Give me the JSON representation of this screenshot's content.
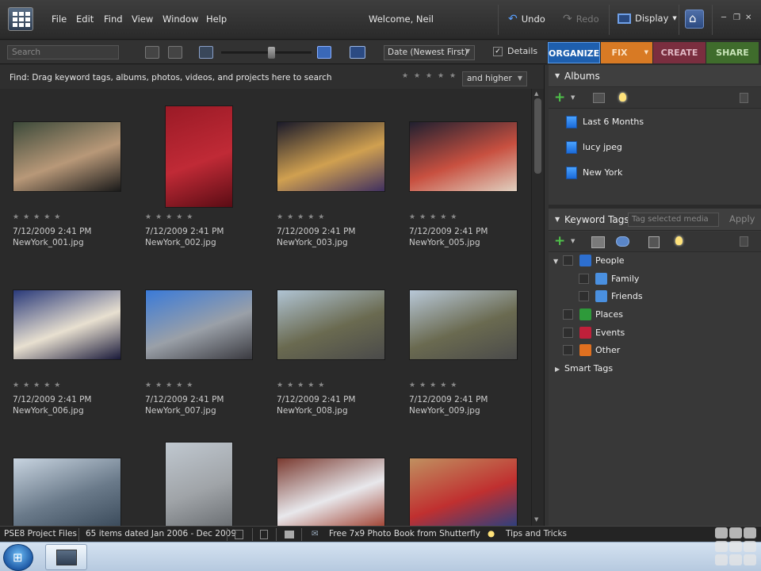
{
  "menubar": {
    "items": [
      "File",
      "Edit",
      "Find",
      "View",
      "Window",
      "Help"
    ],
    "welcome": "Welcome, Neil",
    "undo": "Undo",
    "redo": "Redo",
    "display": "Display"
  },
  "toolbar": {
    "search_placeholder": "Search",
    "sort": "Date (Newest First)",
    "details_label": "Details",
    "details_checked": true
  },
  "modes": [
    {
      "label": "ORGANIZE",
      "color": "#1e5fae"
    },
    {
      "label": "FIX",
      "color": "#d87a24"
    },
    {
      "label": "CREATE",
      "color": "#7a2e3f"
    },
    {
      "label": "SHARE",
      "color": "#3f6c2c"
    }
  ],
  "findbar": {
    "text": "Find: Drag keyword tags, albums, photos, videos, and projects here to search",
    "rating_select": "and higher"
  },
  "photos": [
    {
      "date": "7/12/2009 2:41 PM",
      "file": "NewYork_001.jpg",
      "stars": "★★★★★",
      "colors": [
        "#3c4a3a",
        "#b89878",
        "#1a1a1a"
      ]
    },
    {
      "date": "7/12/2009 2:41 PM",
      "file": "NewYork_002.jpg",
      "stars": "★★★★★",
      "colors": [
        "#9a1a26",
        "#c02a36",
        "#5a0c14"
      ]
    },
    {
      "date": "7/12/2009 2:41 PM",
      "file": "NewYork_003.jpg",
      "stars": "★★★★★",
      "colors": [
        "#1a1a2a",
        "#d0a050",
        "#403060"
      ]
    },
    {
      "date": "7/12/2009 2:41 PM",
      "file": "NewYork_005.jpg",
      "stars": "★★★★★",
      "colors": [
        "#202030",
        "#c85040",
        "#e0d0c0"
      ]
    },
    {
      "date": "7/12/2009 2:41 PM",
      "file": "NewYork_006.jpg",
      "stars": "★★★★★",
      "colors": [
        "#2a3a7a",
        "#e8e0d0",
        "#1a1a3a"
      ]
    },
    {
      "date": "7/12/2009 2:41 PM",
      "file": "NewYork_007.jpg",
      "stars": "★★★★★",
      "colors": [
        "#3a7ad8",
        "#9aa0a8",
        "#3a3a40"
      ]
    },
    {
      "date": "7/12/2009 2:41 PM",
      "file": "NewYork_008.jpg",
      "stars": "★★★★★",
      "colors": [
        "#b0c4d4",
        "#6a6a50",
        "#4a4a4a"
      ]
    },
    {
      "date": "7/12/2009 2:41 PM",
      "file": "NewYork_009.jpg",
      "stars": "★★★★★",
      "colors": [
        "#b8c8d8",
        "#6a6a50",
        "#4a4a4a"
      ]
    },
    {
      "date": "",
      "file": "",
      "stars": "",
      "colors": [
        "#c8d4e0",
        "#6a7a8a",
        "#3a4a5a"
      ]
    },
    {
      "date": "",
      "file": "",
      "stars": "",
      "colors": [
        "#c0c8d0",
        "#a0a4a8",
        "#6a6e72"
      ]
    },
    {
      "date": "",
      "file": "",
      "stars": "",
      "colors": [
        "#7a3a30",
        "#e8e8ec",
        "#a04030"
      ]
    },
    {
      "date": "",
      "file": "",
      "stars": "",
      "colors": [
        "#c09060",
        "#c03030",
        "#284080"
      ]
    }
  ],
  "albums": {
    "title": "Albums",
    "items": [
      "Last 6 Months",
      "lucy jpeg",
      "New York"
    ]
  },
  "keywords": {
    "title": "Keyword Tags",
    "search_placeholder": "Tag selected media",
    "apply": "Apply",
    "tags": [
      {
        "label": "People",
        "color": "#2d6fd0",
        "level": 0
      },
      {
        "label": "Family",
        "color": "#4a90e0",
        "level": 1
      },
      {
        "label": "Friends",
        "color": "#4a90e0",
        "level": 1
      },
      {
        "label": "Places",
        "color": "#2e9a3a",
        "level": 0
      },
      {
        "label": "Events",
        "color": "#c0203a",
        "level": 0
      },
      {
        "label": "Other",
        "color": "#e07020",
        "level": 0
      }
    ],
    "smart_tags": "Smart Tags"
  },
  "status": {
    "project": "PSE8 Project Files",
    "items": "65 items dated Jan 2006 - Dec 2009",
    "promo": "Free 7x9 Photo Book from Shutterfly",
    "tips": "Tips and Tricks"
  }
}
